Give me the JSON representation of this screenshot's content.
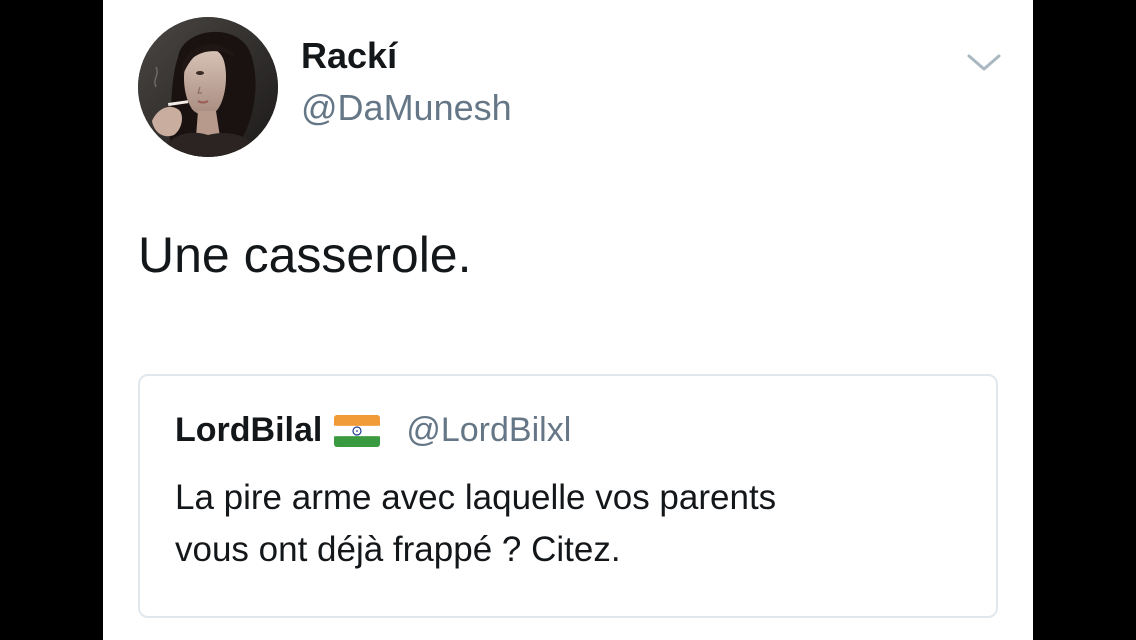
{
  "tweet": {
    "author": {
      "display_name": "Rackí",
      "handle": "@DaMunesh",
      "avatar": "portrait-photo"
    },
    "menu_icon": "chevron-down-icon",
    "text": "Une casserole.",
    "quoted": {
      "display_name": "LordBilal",
      "flag_icon": "india-flag-emoji",
      "handle": "@LordBilxl",
      "text": "La pire arme avec laquelle vos parents\nvous ont déjà frappé ? Citez."
    }
  },
  "colors": {
    "background": "#000000",
    "card": "#ffffff",
    "primary_text": "#14171a",
    "secondary_text": "#657786",
    "border": "#e1e8ed"
  }
}
